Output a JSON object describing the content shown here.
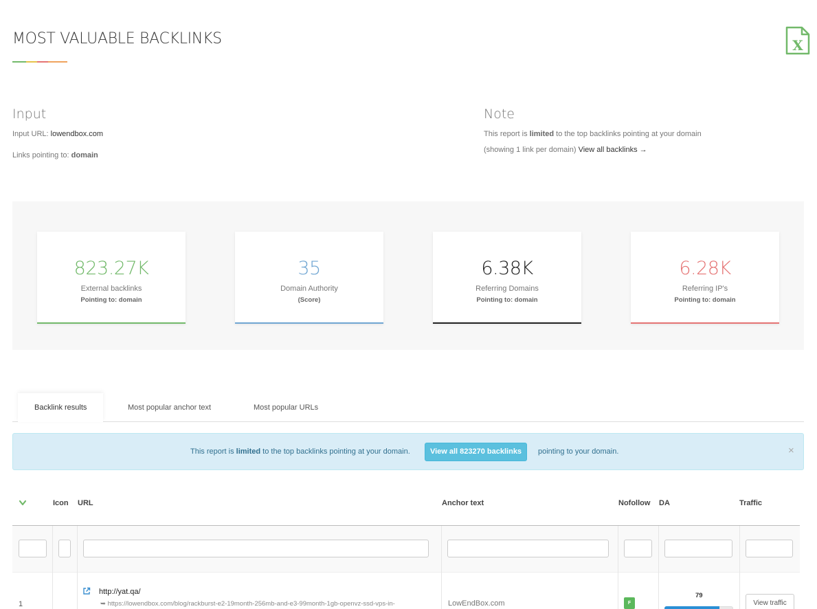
{
  "page": {
    "title": "MOST VALUABLE BACKLINKS",
    "export_icon": "excel-icon"
  },
  "input": {
    "heading": "Input",
    "url_label": "Input URL:",
    "url_value": "lowendbox.com",
    "links_label": "Links pointing to:",
    "links_value": "domain"
  },
  "note": {
    "heading": "Note",
    "line1_a": "This report is",
    "line1_b": "limited",
    "line1_c": "to the top backlinks pointing at your domain",
    "line2_a": "(showing 1 link per domain)",
    "line2_link": "View all backlinks →"
  },
  "stats": [
    {
      "value": "823.27K",
      "label": "External backlinks",
      "sub": "Pointing to: domain",
      "color": "#72b96a"
    },
    {
      "value": "35",
      "label": "Domain Authority",
      "sub": "(Score)",
      "color": "#6fa5d2"
    },
    {
      "value": "6.38K",
      "label": "Referring Domains",
      "sub": "Pointing to: domain",
      "color": "#222222"
    },
    {
      "value": "6.28K",
      "label": "Referring IP's",
      "sub": "Pointing to: domain",
      "color": "#e57373"
    }
  ],
  "tabs": [
    {
      "label": "Backlink results"
    },
    {
      "label": "Most popular anchor text"
    },
    {
      "label": "Most popular URLs"
    }
  ],
  "alert": {
    "text_a": "This report is",
    "text_b": "limited",
    "text_c": "to the top backlinks pointing at your domain.",
    "button": "View all 823270 backlinks",
    "text_after": "pointing to your domain.",
    "close": "×"
  },
  "table": {
    "sort_icon": "chevron-down-icon",
    "headers": {
      "icon": "Icon",
      "url": "URL",
      "anchor": "Anchor text",
      "nofollow": "Nofollow",
      "da": "DA",
      "traffic": "Traffic"
    },
    "rows": [
      {
        "index": "1",
        "source_url": "http://yat.qa/",
        "target_url": "➥ https://lowendbox.com/blog/rackburst-e2-19month-256mb-and-e3-99month-1gb-openvz-ssd-vps-in-",
        "anchor": "LowEndBox.com",
        "nofollow": "F",
        "da": "79",
        "traffic_button": "View traffic"
      }
    ]
  }
}
